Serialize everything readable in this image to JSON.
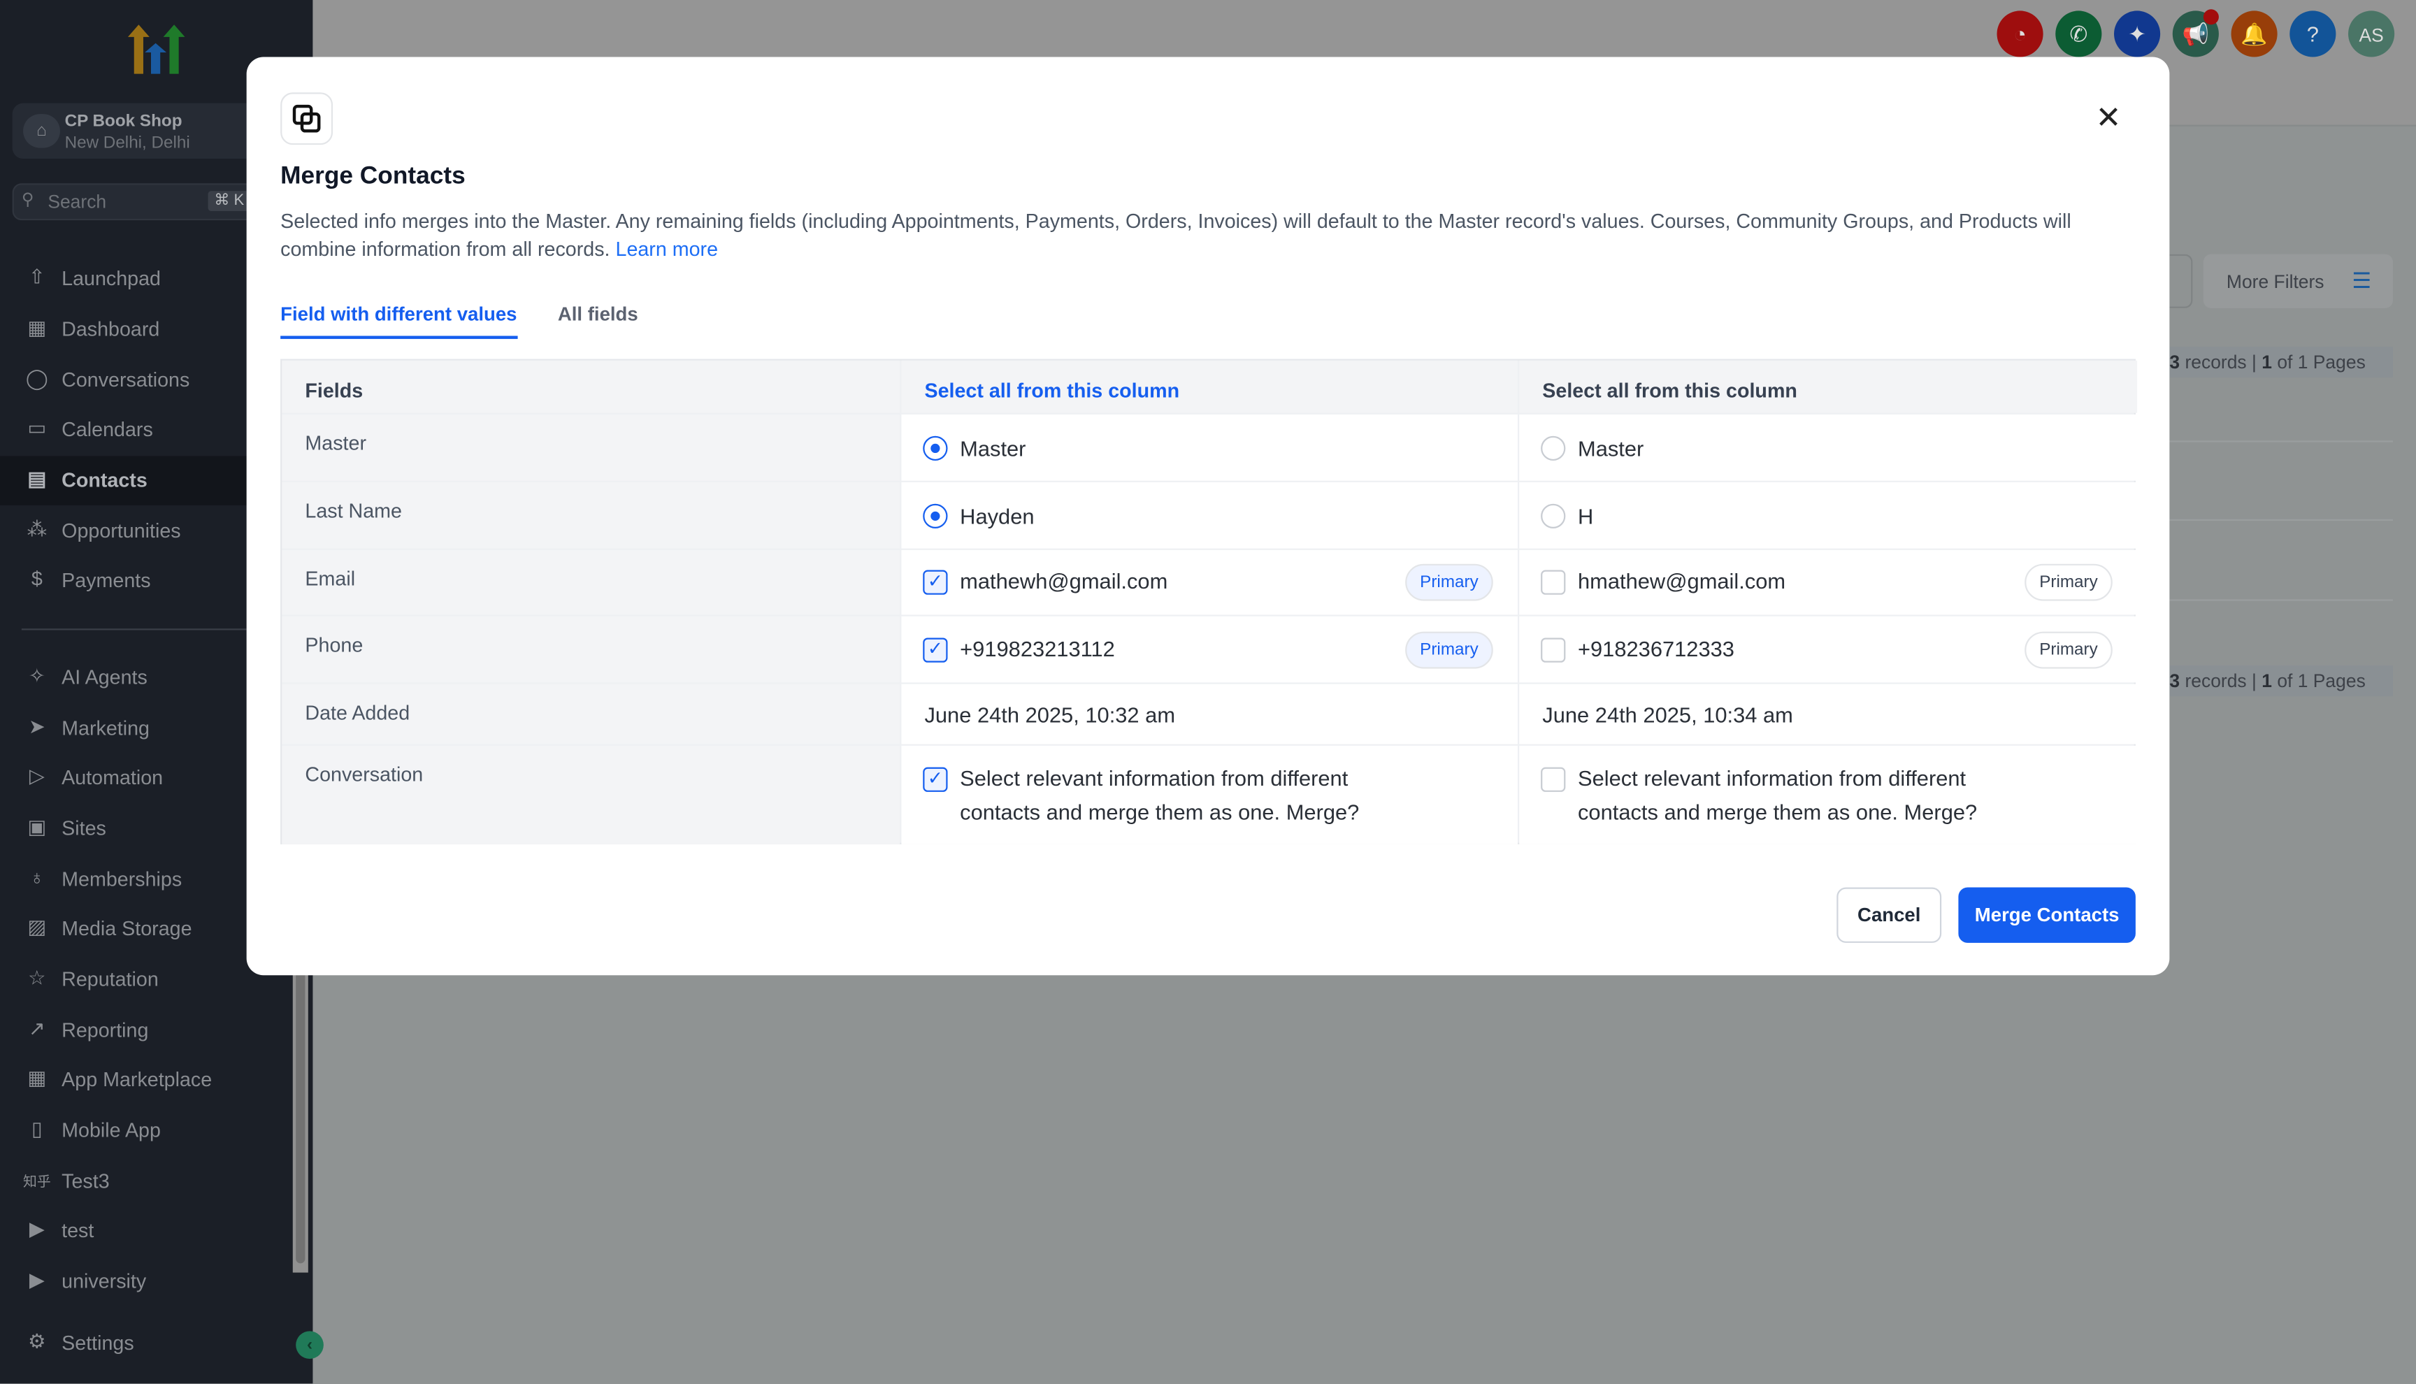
{
  "sidebar": {
    "location": {
      "name": "CP Book Shop",
      "city": "New Delhi, Delhi"
    },
    "search": {
      "placeholder": "Search",
      "shortcut": "⌘ K"
    },
    "items": [
      {
        "label": "Launchpad",
        "icon": "launchpad-icon"
      },
      {
        "label": "Dashboard",
        "icon": "dashboard-icon"
      },
      {
        "label": "Conversations",
        "icon": "chat-bubble-icon"
      },
      {
        "label": "Calendars",
        "icon": "calendar-icon"
      },
      {
        "label": "Contacts",
        "icon": "contacts-icon",
        "active": true
      },
      {
        "label": "Opportunities",
        "icon": "opportunities-icon"
      },
      {
        "label": "Payments",
        "icon": "payments-icon"
      },
      {
        "label": "AI Agents",
        "icon": "ai-sparkle-icon"
      },
      {
        "label": "Marketing",
        "icon": "send-icon"
      },
      {
        "label": "Automation",
        "icon": "automation-icon"
      },
      {
        "label": "Sites",
        "icon": "sites-icon"
      },
      {
        "label": "Memberships",
        "icon": "membership-icon"
      },
      {
        "label": "Media Storage",
        "icon": "image-icon"
      },
      {
        "label": "Reputation",
        "icon": "star-icon"
      },
      {
        "label": "Reporting",
        "icon": "trend-icon"
      },
      {
        "label": "App Marketplace",
        "icon": "grid-icon"
      },
      {
        "label": "Mobile App",
        "icon": "phone-device-icon"
      },
      {
        "label": "Test3",
        "icon": "zhihu-icon",
        "icon_text": "知乎"
      },
      {
        "label": "test",
        "icon": "video-icon"
      },
      {
        "label": "university",
        "icon": "youtube-icon"
      },
      {
        "label": "Settings",
        "icon": "gear-icon"
      }
    ]
  },
  "topbar": {
    "icons": [
      {
        "name": "speedometer-icon",
        "color": "#9e0e0e",
        "glyph": "◔"
      },
      {
        "name": "phone-icon",
        "color": "#0c5c33",
        "glyph": "✆"
      },
      {
        "name": "sparkle-icon",
        "color": "#11388f",
        "glyph": "✦"
      },
      {
        "name": "megaphone-icon",
        "color": "#295a4a",
        "glyph": "📢"
      },
      {
        "name": "bell-icon",
        "color": "#983e09",
        "glyph": "🔔"
      },
      {
        "name": "help-icon",
        "color": "#125498",
        "glyph": "?"
      },
      {
        "name": "avatar",
        "color": "#4a7566",
        "glyph": "AS"
      }
    ]
  },
  "background": {
    "more_filters": "More Filters",
    "records_count": "3",
    "records_label": " records | ",
    "page_current": "1",
    "page_label": " of 1 Pages"
  },
  "modal": {
    "title": "Merge Contacts",
    "description": "Selected info merges into the Master. Any remaining fields (including Appointments, Payments, Orders, Invoices) will default to the Master record's values. Courses, Community Groups, and Products will combine information from all records.",
    "learn_more": "Learn more",
    "tabs": [
      {
        "label": "Field with different values",
        "active": true
      },
      {
        "label": "All fields"
      }
    ],
    "table": {
      "header": {
        "fields": "Fields",
        "col1": "Select all from this column",
        "col2": "Select all from this column"
      },
      "rows": [
        {
          "field": "Master",
          "a": "Master",
          "b": "Master",
          "type": "radio",
          "a_selected": true
        },
        {
          "field": "Last Name",
          "a": "Hayden",
          "b": "H",
          "type": "radio",
          "a_selected": true
        },
        {
          "field": "Email",
          "a": "mathewh@gmail.com",
          "b": "hmathew@gmail.com",
          "type": "checkbox",
          "a_checked": true,
          "b_checked": false,
          "badge": "Primary"
        },
        {
          "field": "Phone",
          "a": "+919823213112",
          "b": "+918236712333",
          "type": "checkbox",
          "a_checked": true,
          "b_checked": false,
          "badge": "Primary"
        },
        {
          "field": "Date Added",
          "a": "June 24th 2025, 10:32 am",
          "b": "June 24th 2025, 10:34 am",
          "type": "text"
        },
        {
          "field": "Conversation",
          "a": "Select relevant information from different contacts and merge them as one. Merge?",
          "b": "Select relevant information from different contacts and merge them as one. Merge?",
          "type": "checkbox",
          "a_checked": true,
          "b_checked": false
        }
      ]
    },
    "cancel": "Cancel",
    "merge": "Merge Contacts"
  },
  "colors": {
    "accent": "#155eef",
    "sidebar_bg": "#1b1f27"
  }
}
